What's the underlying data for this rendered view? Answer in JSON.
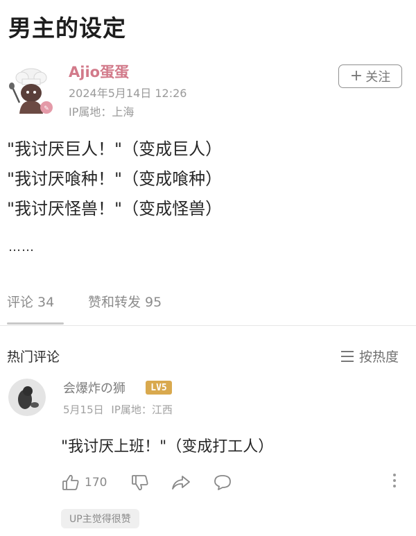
{
  "page": {
    "title": "男主的设定"
  },
  "post": {
    "author": "Ajio蛋蛋",
    "date": "2024年5月14日 12:26",
    "ip": "IP属地：上海",
    "follow_plus": "+",
    "follow_label": "关注",
    "lines": [
      "\"我讨厌巨人！\"（变成巨人）",
      "\"我讨厌喰种！\"（变成喰种）",
      "\"我讨厌怪兽！\"（变成怪兽）"
    ],
    "ellipsis": "……"
  },
  "tabs": [
    {
      "label": "评论 34",
      "active": true
    },
    {
      "label": "赞和转发 95",
      "active": false
    }
  ],
  "comments_section": {
    "title": "热门评论",
    "sort_label": "按热度",
    "sort_icon": "list-icon"
  },
  "comment": {
    "username": "会爆炸の狮",
    "level_badge": "LV5",
    "date": "5月15日",
    "ip": "IP属地：江西",
    "text": "\"我讨厌上班！\"（变成打工人）",
    "like_count": "170",
    "up_badge": "UP主觉得很赞",
    "icons": [
      "thumbs-up-icon",
      "thumbs-down-icon",
      "share-icon",
      "comment-icon",
      "more-icon"
    ]
  },
  "colors": {
    "author_name": "#d27a8a",
    "badge": "#d9a94e",
    "muted_text": "#9a9a9a"
  }
}
